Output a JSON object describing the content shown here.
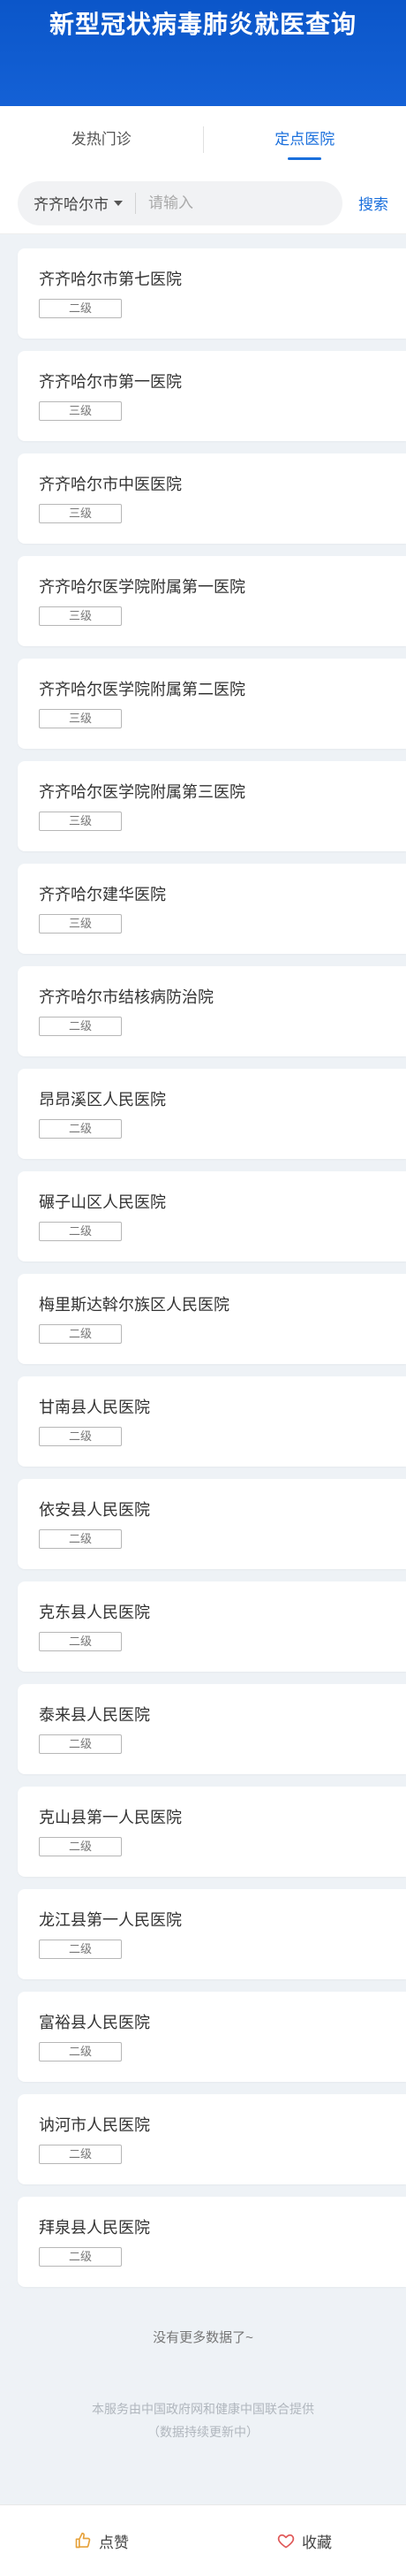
{
  "header": {
    "title": "新型冠状病毒肺炎就医查询"
  },
  "tabs": [
    {
      "label": "发热门诊",
      "active": false
    },
    {
      "label": "定点医院",
      "active": true
    }
  ],
  "search": {
    "city": "齐齐哈尔市",
    "placeholder": "请输入",
    "button_label": "搜索"
  },
  "hospitals": [
    {
      "name": "齐齐哈尔市第七医院",
      "level": "二级"
    },
    {
      "name": "齐齐哈尔市第一医院",
      "level": "三级"
    },
    {
      "name": "齐齐哈尔市中医医院",
      "level": "三级"
    },
    {
      "name": "齐齐哈尔医学院附属第一医院",
      "level": "三级"
    },
    {
      "name": "齐齐哈尔医学院附属第二医院",
      "level": "三级"
    },
    {
      "name": "齐齐哈尔医学院附属第三医院",
      "level": "三级"
    },
    {
      "name": "齐齐哈尔建华医院",
      "level": "三级"
    },
    {
      "name": "齐齐哈尔市结核病防治院",
      "level": "二级"
    },
    {
      "name": "昂昂溪区人民医院",
      "level": "二级"
    },
    {
      "name": "碾子山区人民医院",
      "level": "二级"
    },
    {
      "name": "梅里斯达斡尔族区人民医院",
      "level": "二级"
    },
    {
      "name": "甘南县人民医院",
      "level": "二级"
    },
    {
      "name": "依安县人民医院",
      "level": "二级"
    },
    {
      "name": "克东县人民医院",
      "level": "二级"
    },
    {
      "name": "泰来县人民医院",
      "level": "二级"
    },
    {
      "name": "克山县第一人民医院",
      "level": "二级"
    },
    {
      "name": "龙江县第一人民医院",
      "level": "二级"
    },
    {
      "name": "富裕县人民医院",
      "level": "二级"
    },
    {
      "name": "讷河市人民医院",
      "level": "二级"
    },
    {
      "name": "拜泉县人民医院",
      "level": "二级"
    }
  ],
  "list_end": "没有更多数据了~",
  "footnote": {
    "line1": "本服务由中国政府网和健康中国联合提供",
    "line2": "（数据持续更新中）"
  },
  "bottom_bar": {
    "like_label": "点赞",
    "collect_label": "收藏",
    "like_icon": "thumbs-up-icon",
    "collect_icon": "heart-icon"
  },
  "colors": {
    "header_blue": "#0b56c9",
    "accent": "#1a6fdc",
    "like_icon": "#e6a23c",
    "heart_icon": "#e05a5a"
  }
}
